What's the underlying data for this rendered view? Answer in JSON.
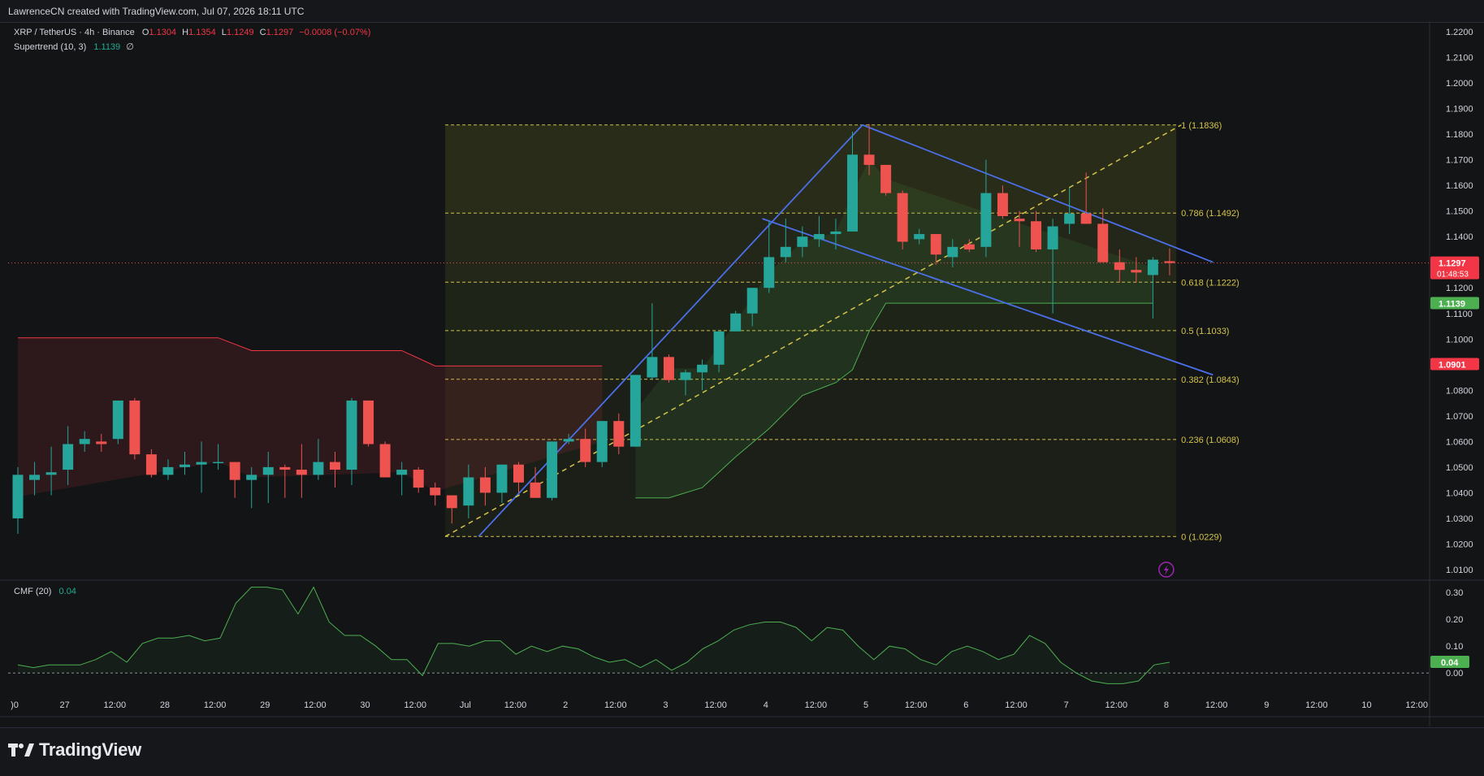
{
  "header": {
    "credit": "LawrenceCN created with TradingView.com, Jul 07, 2026 18:11 UTC"
  },
  "legend": {
    "symbol": "XRP / TetherUS · 4h · Binance",
    "o_label": "O",
    "o_value": "1.1304",
    "h_label": "H",
    "h_value": "1.1354",
    "l_label": "L",
    "l_value": "1.1249",
    "c_label": "C",
    "c_value": "1.1297",
    "change": "−0.0008 (−0.07%)",
    "supertrend_label": "Supertrend (10, 3)",
    "supertrend_value": "1.1139",
    "supertrend_icon": "∅",
    "cmf_label": "CMF (20)",
    "cmf_value": "0.04"
  },
  "brand": {
    "name": "TradingView"
  },
  "colors": {
    "bull": "#26a69a",
    "bear": "#ef5350",
    "supertrend_up": "#4caf50",
    "supertrend_down": "#f23645",
    "trendline": "#4a6fe8",
    "fib": "#d4c44a",
    "background": "#131416"
  },
  "chart_data": [
    {
      "type": "candlestick",
      "title": "XRP / TetherUS · 4h · Binance",
      "y_axis_ticks": [
        "1.2200",
        "1.2100",
        "1.2000",
        "1.1900",
        "1.1800",
        "1.1700",
        "1.1600",
        "1.1500",
        "1.1400",
        "1.1300",
        "1.1200",
        "1.1100",
        "1.1000",
        "1.0900",
        "1.0800",
        "1.0700",
        "1.0600",
        "1.0500",
        "1.0400",
        "1.0300",
        "1.0200",
        "1.0100"
      ],
      "ylim": [
        1.0065,
        1.2235
      ],
      "x_axis_labels": [
        ")0",
        "27",
        "12:00",
        "28",
        "12:00",
        "29",
        "12:00",
        "30",
        "12:00",
        "Jul",
        "12:00",
        "2",
        "12:00",
        "3",
        "12:00",
        "4",
        "12:00",
        "5",
        "12:00",
        "6",
        "12:00",
        "7",
        "12:00",
        "8",
        "12:00",
        "9",
        "12:00",
        "10",
        "12:00"
      ],
      "candles": [
        {
          "o": 1.03,
          "h": 1.05,
          "l": 1.024,
          "c": 1.047
        },
        {
          "o": 1.045,
          "h": 1.052,
          "l": 1.039,
          "c": 1.047
        },
        {
          "o": 1.047,
          "h": 1.058,
          "l": 1.039,
          "c": 1.048
        },
        {
          "o": 1.049,
          "h": 1.066,
          "l": 1.043,
          "c": 1.059
        },
        {
          "o": 1.059,
          "h": 1.064,
          "l": 1.056,
          "c": 1.061
        },
        {
          "o": 1.06,
          "h": 1.063,
          "l": 1.056,
          "c": 1.059
        },
        {
          "o": 1.061,
          "h": 1.076,
          "l": 1.059,
          "c": 1.076
        },
        {
          "o": 1.076,
          "h": 1.077,
          "l": 1.053,
          "c": 1.055
        },
        {
          "o": 1.055,
          "h": 1.057,
          "l": 1.046,
          "c": 1.047
        },
        {
          "o": 1.047,
          "h": 1.053,
          "l": 1.045,
          "c": 1.05
        },
        {
          "o": 1.05,
          "h": 1.056,
          "l": 1.047,
          "c": 1.051
        },
        {
          "o": 1.051,
          "h": 1.06,
          "l": 1.04,
          "c": 1.052
        },
        {
          "o": 1.052,
          "h": 1.059,
          "l": 1.049,
          "c": 1.052
        },
        {
          "o": 1.052,
          "h": 1.052,
          "l": 1.038,
          "c": 1.045
        },
        {
          "o": 1.045,
          "h": 1.05,
          "l": 1.034,
          "c": 1.047
        },
        {
          "o": 1.047,
          "h": 1.056,
          "l": 1.036,
          "c": 1.05
        },
        {
          "o": 1.05,
          "h": 1.051,
          "l": 1.038,
          "c": 1.049
        },
        {
          "o": 1.049,
          "h": 1.059,
          "l": 1.038,
          "c": 1.047
        },
        {
          "o": 1.047,
          "h": 1.061,
          "l": 1.045,
          "c": 1.052
        },
        {
          "o": 1.052,
          "h": 1.056,
          "l": 1.042,
          "c": 1.049
        },
        {
          "o": 1.049,
          "h": 1.077,
          "l": 1.043,
          "c": 1.076
        },
        {
          "o": 1.076,
          "h": 1.076,
          "l": 1.058,
          "c": 1.059
        },
        {
          "o": 1.059,
          "h": 1.06,
          "l": 1.046,
          "c": 1.046
        },
        {
          "o": 1.047,
          "h": 1.052,
          "l": 1.039,
          "c": 1.049
        },
        {
          "o": 1.049,
          "h": 1.05,
          "l": 1.04,
          "c": 1.042
        },
        {
          "o": 1.042,
          "h": 1.044,
          "l": 1.035,
          "c": 1.039
        },
        {
          "o": 1.039,
          "h": 1.039,
          "l": 1.028,
          "c": 1.034
        },
        {
          "o": 1.035,
          "h": 1.051,
          "l": 1.03,
          "c": 1.046
        },
        {
          "o": 1.046,
          "h": 1.05,
          "l": 1.035,
          "c": 1.04
        },
        {
          "o": 1.04,
          "h": 1.051,
          "l": 1.036,
          "c": 1.051
        },
        {
          "o": 1.051,
          "h": 1.052,
          "l": 1.04,
          "c": 1.044
        },
        {
          "o": 1.044,
          "h": 1.05,
          "l": 1.038,
          "c": 1.038
        },
        {
          "o": 1.038,
          "h": 1.06,
          "l": 1.037,
          "c": 1.06
        },
        {
          "o": 1.06,
          "h": 1.063,
          "l": 1.059,
          "c": 1.061
        },
        {
          "o": 1.061,
          "h": 1.065,
          "l": 1.05,
          "c": 1.052
        },
        {
          "o": 1.052,
          "h": 1.068,
          "l": 1.05,
          "c": 1.068
        },
        {
          "o": 1.068,
          "h": 1.071,
          "l": 1.055,
          "c": 1.058
        },
        {
          "o": 1.058,
          "h": 1.086,
          "l": 1.058,
          "c": 1.086
        },
        {
          "o": 1.085,
          "h": 1.114,
          "l": 1.084,
          "c": 1.093
        },
        {
          "o": 1.093,
          "h": 1.094,
          "l": 1.083,
          "c": 1.084
        },
        {
          "o": 1.084,
          "h": 1.088,
          "l": 1.078,
          "c": 1.087
        },
        {
          "o": 1.087,
          "h": 1.092,
          "l": 1.08,
          "c": 1.09
        },
        {
          "o": 1.09,
          "h": 1.103,
          "l": 1.087,
          "c": 1.103
        },
        {
          "o": 1.103,
          "h": 1.111,
          "l": 1.103,
          "c": 1.11
        },
        {
          "o": 1.11,
          "h": 1.12,
          "l": 1.105,
          "c": 1.12
        },
        {
          "o": 1.12,
          "h": 1.146,
          "l": 1.118,
          "c": 1.132
        },
        {
          "o": 1.132,
          "h": 1.147,
          "l": 1.13,
          "c": 1.136
        },
        {
          "o": 1.136,
          "h": 1.144,
          "l": 1.132,
          "c": 1.14
        },
        {
          "o": 1.139,
          "h": 1.148,
          "l": 1.136,
          "c": 1.141
        },
        {
          "o": 1.141,
          "h": 1.147,
          "l": 1.135,
          "c": 1.142
        },
        {
          "o": 1.142,
          "h": 1.181,
          "l": 1.142,
          "c": 1.172
        },
        {
          "o": 1.172,
          "h": 1.184,
          "l": 1.164,
          "c": 1.168
        },
        {
          "o": 1.168,
          "h": 1.168,
          "l": 1.156,
          "c": 1.157
        },
        {
          "o": 1.157,
          "h": 1.158,
          "l": 1.135,
          "c": 1.138
        },
        {
          "o": 1.139,
          "h": 1.143,
          "l": 1.137,
          "c": 1.141
        },
        {
          "o": 1.141,
          "h": 1.141,
          "l": 1.129,
          "c": 1.133
        },
        {
          "o": 1.132,
          "h": 1.139,
          "l": 1.128,
          "c": 1.136
        },
        {
          "o": 1.137,
          "h": 1.139,
          "l": 1.134,
          "c": 1.135
        },
        {
          "o": 1.136,
          "h": 1.17,
          "l": 1.132,
          "c": 1.157
        },
        {
          "o": 1.157,
          "h": 1.16,
          "l": 1.147,
          "c": 1.148
        },
        {
          "o": 1.147,
          "h": 1.15,
          "l": 1.136,
          "c": 1.146
        },
        {
          "o": 1.146,
          "h": 1.15,
          "l": 1.134,
          "c": 1.135
        },
        {
          "o": 1.135,
          "h": 1.147,
          "l": 1.11,
          "c": 1.144
        },
        {
          "o": 1.145,
          "h": 1.159,
          "l": 1.141,
          "c": 1.149
        },
        {
          "o": 1.149,
          "h": 1.165,
          "l": 1.145,
          "c": 1.145
        },
        {
          "o": 1.145,
          "h": 1.151,
          "l": 1.139,
          "c": 1.13
        },
        {
          "o": 1.13,
          "h": 1.135,
          "l": 1.122,
          "c": 1.127
        },
        {
          "o": 1.127,
          "h": 1.132,
          "l": 1.122,
          "c": 1.126
        },
        {
          "o": 1.125,
          "h": 1.132,
          "l": 1.108,
          "c": 1.131
        },
        {
          "o": 1.1304,
          "h": 1.1354,
          "l": 1.1249,
          "c": 1.1297
        }
      ],
      "supertrend": {
        "down": [
          [
            0,
            1.1005
          ],
          [
            12,
            1.1005
          ],
          [
            14,
            1.0955
          ],
          [
            23,
            1.0955
          ],
          [
            25,
            1.0895
          ],
          [
            35,
            1.0895
          ]
        ],
        "up": [
          [
            37,
            1.038
          ],
          [
            39,
            1.038
          ],
          [
            41,
            1.042
          ],
          [
            43,
            1.054
          ],
          [
            45,
            1.065
          ],
          [
            47,
            1.078
          ],
          [
            49,
            1.083
          ],
          [
            50,
            1.088
          ],
          [
            51,
            1.103
          ],
          [
            52,
            1.114
          ],
          [
            68,
            1.114
          ]
        ]
      },
      "fibonacci": {
        "levels": [
          {
            "ratio": "1",
            "value": 1.1836,
            "label": "1 (1.1836)"
          },
          {
            "ratio": "0.786",
            "value": 1.1492,
            "label": "0.786 (1.1492)"
          },
          {
            "ratio": "0.618",
            "value": 1.1222,
            "label": "0.618 (1.1222)"
          },
          {
            "ratio": "0.5",
            "value": 1.1033,
            "label": "0.5 (1.1033)"
          },
          {
            "ratio": "0.382",
            "value": 1.0843,
            "label": "0.382 (1.0843)"
          },
          {
            "ratio": "0.236",
            "value": 1.0608,
            "label": "0.236 (1.0608)"
          },
          {
            "ratio": "0",
            "value": 1.0229,
            "label": "0 (1.0229)"
          }
        ],
        "from_bar": 25.6,
        "to_bar": 69.4
      },
      "trendlines": [
        {
          "from": [
            27.6,
            1.0229
          ],
          "to": [
            50.6,
            1.1836
          ]
        },
        {
          "from": [
            50.6,
            1.1836
          ],
          "to": [
            71.6,
            1.13
          ]
        },
        {
          "from": [
            44.6,
            1.147
          ],
          "to": [
            71.6,
            1.086
          ]
        },
        {
          "from": [
            25.6,
            1.0229
          ],
          "to": [
            69.7,
            1.1836
          ],
          "dashed": true
        }
      ],
      "price_labels": [
        {
          "value": 1.1297,
          "text": "1.1297",
          "sub": "01:48:53",
          "color": "#f23645"
        },
        {
          "value": 1.1139,
          "text": "1.1139",
          "color": "#4caf50"
        },
        {
          "value": 1.0901,
          "text": "1.0901",
          "color": "#f23645"
        }
      ],
      "current_price": 1.1297
    },
    {
      "type": "line",
      "title": "CMF (20)",
      "y_axis_ticks": [
        "0.30",
        "0.20",
        "0.10",
        "0.00"
      ],
      "ylim": [
        -0.06,
        0.34
      ],
      "values": [
        0.03,
        0.02,
        0.03,
        0.03,
        0.03,
        0.05,
        0.08,
        0.04,
        0.11,
        0.13,
        0.13,
        0.14,
        0.12,
        0.13,
        0.26,
        0.32,
        0.32,
        0.31,
        0.22,
        0.32,
        0.19,
        0.14,
        0.14,
        0.1,
        0.05,
        0.05,
        -0.01,
        0.11,
        0.11,
        0.1,
        0.12,
        0.12,
        0.07,
        0.1,
        0.08,
        0.1,
        0.09,
        0.06,
        0.04,
        0.05,
        0.02,
        0.05,
        0.01,
        0.04,
        0.09,
        0.12,
        0.16,
        0.18,
        0.19,
        0.19,
        0.17,
        0.12,
        0.17,
        0.16,
        0.1,
        0.05,
        0.1,
        0.09,
        0.05,
        0.03,
        0.08,
        0.1,
        0.08,
        0.05,
        0.07,
        0.14,
        0.11,
        0.04,
        0.0,
        -0.03,
        -0.04,
        -0.04,
        -0.03,
        0.03,
        0.04
      ],
      "current_value": "0.04"
    }
  ]
}
